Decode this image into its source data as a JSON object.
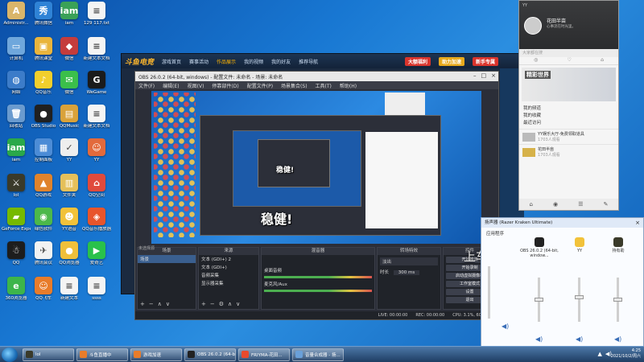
{
  "desktop": {
    "icons": [
      {
        "label": "Administr...",
        "color": "#d9b56a",
        "glyph": "A"
      },
      {
        "label": "腾讯微信",
        "color": "#2f83d6",
        "glyph": "秀"
      },
      {
        "label": "iam",
        "color": "#3aa157",
        "glyph": "iam"
      },
      {
        "label": "129 117.txt",
        "color": "#f4f4f4",
        "glyph": "≡"
      },
      {
        "label": "计算机",
        "color": "#6fa7dc",
        "glyph": "▭"
      },
      {
        "label": "腾讯课堂",
        "color": "#e9b43c",
        "glyph": "▣"
      },
      {
        "label": "微信",
        "color": "#c43c3c",
        "glyph": "◆"
      },
      {
        "label": "新建文本文档",
        "color": "#f4f4f4",
        "glyph": "≡"
      },
      {
        "label": "网络",
        "color": "#3c7cc9",
        "glyph": "◍"
      },
      {
        "label": "QQ音乐",
        "color": "#f2cf2c",
        "glyph": "♪"
      },
      {
        "label": "微信",
        "color": "#3bbf4a",
        "glyph": "✉"
      },
      {
        "label": "WeGame",
        "color": "#1b1b1b",
        "glyph": "G"
      },
      {
        "label": "回收站",
        "color": "#6a9bcf",
        "glyph": "🗑"
      },
      {
        "label": "OBS Studio",
        "color": "#202020",
        "glyph": "●"
      },
      {
        "label": "QQMusic",
        "color": "#d9a23a",
        "glyph": "▤"
      },
      {
        "label": "新建文本文档",
        "color": "#f4f4f4",
        "glyph": "≡"
      },
      {
        "label": "iam",
        "color": "#2aa84a",
        "glyph": "iam"
      },
      {
        "label": "控制面板",
        "color": "#4c8cd6",
        "glyph": "▦"
      },
      {
        "label": "YY",
        "color": "#eeeeee",
        "glyph": "✓"
      },
      {
        "label": "YY",
        "color": "#e36a3c",
        "glyph": "☺"
      },
      {
        "label": "lol",
        "color": "#3a3a2a",
        "glyph": "⚔"
      },
      {
        "label": "QQ游戏",
        "color": "#e0832c",
        "glyph": "▲"
      },
      {
        "label": "文件夹",
        "color": "#e5c05a",
        "glyph": "▥"
      },
      {
        "label": "QQ空间",
        "color": "#e04a3c",
        "glyph": "⌂"
      },
      {
        "label": "GeForce Experience",
        "color": "#76b900",
        "glyph": "▰"
      },
      {
        "label": "绿色软件",
        "color": "#4cb84a",
        "glyph": "◉"
      },
      {
        "label": "YY语音",
        "color": "#f2c23a",
        "glyph": "☻"
      },
      {
        "label": "QQ音乐播放器",
        "color": "#e8552c",
        "glyph": "◈"
      },
      {
        "label": "QQ",
        "color": "#1d1d1d",
        "glyph": "☃"
      },
      {
        "label": "腾讯会议",
        "color": "#f2f2f2",
        "glyph": "✈"
      },
      {
        "label": "QQ浏览器",
        "color": "#f0c03a",
        "glyph": "●"
      },
      {
        "label": "爱奇艺",
        "color": "#29c14b",
        "glyph": "▶"
      },
      {
        "label": "360浏览器",
        "color": "#3db54a",
        "glyph": "e"
      },
      {
        "label": "QQ飞车",
        "color": "#e87c2a",
        "glyph": "☺"
      },
      {
        "label": "新建文本",
        "color": "#f4f4f4",
        "glyph": "≡"
      },
      {
        "label": "ssss",
        "color": "#f4f4f4",
        "glyph": "≡"
      }
    ]
  },
  "game_client": {
    "logo": "斗鱼电竞",
    "nav": [
      "游戏首页",
      "赛事活动",
      "作品展示",
      "我的视频",
      "我的好友",
      "推荐导航"
    ],
    "active_nav": 2,
    "buttons": [
      {
        "label": "大额福利",
        "color": "#d9342c"
      },
      {
        "label": "助力加速",
        "color": "#e7a91c"
      },
      {
        "label": "新手专属",
        "color": "#d9342c"
      }
    ]
  },
  "obs": {
    "title": "OBS 26.0.2 (64-bit, windows) - 配置文件: 未命名 - 场景: 未命名",
    "menu": [
      "文件(F)",
      "编辑(E)",
      "视图(V)",
      "停靠部件(D)",
      "配置文件(P)",
      "场景集合(S)",
      "工具(T)",
      "帮助(H)"
    ],
    "panels": {
      "scenes_header": "场景",
      "scenes": [
        "场景"
      ],
      "sources_header": "来源",
      "sources": [
        "文本 (GDI+) 2",
        "文本 (GDI+)",
        "音频采集",
        "显示器采集"
      ],
      "mixer_header": "混音器",
      "mixer_items": [
        "桌面音频",
        "麦克风/Aux"
      ],
      "transitions_header": "转场特效",
      "transition_type": "淡出",
      "duration_label": "时长",
      "duration_value": "300 ms",
      "controls_header": "控件",
      "controls": [
        "开始推流",
        "开始录制",
        "启动虚拟摄像机",
        "工作室模式",
        "设置",
        "退出"
      ]
    },
    "status": [
      "LIVE: 00:00:00",
      "REC: 00:00:00",
      "CPU: 3.1%, 60.00 fps"
    ],
    "scene_label": "未选择源"
  },
  "overlay": {
    "big_text": "稳健!",
    "caption": "上车加v:"
  },
  "yy": {
    "app_name": "YY",
    "username": "花田半亩",
    "signature": "心事流在时光里。",
    "search_placeholder": "大家都在搜",
    "tabs": [
      "◎",
      "♡",
      "⌂"
    ],
    "banner_title": "精彩世界",
    "list": [
      "我的频道",
      "我的收藏",
      "最近访问"
    ],
    "items": [
      {
        "title": "YY娱乐大厅-免费领取道具",
        "sub": "1703人观看"
      },
      {
        "title": "花田半亩",
        "sub": "1703人观看"
      }
    ],
    "bottom_icons": [
      "⌂",
      "◉",
      "☰",
      "✎"
    ]
  },
  "volume_mixer": {
    "title": "扬声器 (Razer Kraken Ultimate)",
    "subtitle": "应用程序",
    "apps": [
      {
        "label": "OBS 26.0.2 (64-bit, window...",
        "color": "#222222",
        "level": 0.55
      },
      {
        "label": "YY",
        "color": "#f2c23a",
        "level": 0.6
      },
      {
        "label": "持有助",
        "color": "#3a3a2a",
        "level": 0.55
      }
    ],
    "left_strip_level": 0.5
  },
  "taskbar": {
    "items": [
      {
        "label": "lol",
        "color": "#3a3a2a"
      },
      {
        "label": "斗鱼直播中",
        "color": "#e87c2a"
      },
      {
        "label": "游戏加速",
        "color": "#e87c2a"
      },
      {
        "label": "OBS 26.0.2 (64-bit",
        "color": "#222222"
      },
      {
        "label": "FRIYMA-花田...",
        "color": "#e84a2c"
      },
      {
        "label": "音量合成器 - 扬...",
        "color": "#6aa0d9"
      }
    ],
    "time": "4:25",
    "date": "2021/10/2/周六"
  }
}
